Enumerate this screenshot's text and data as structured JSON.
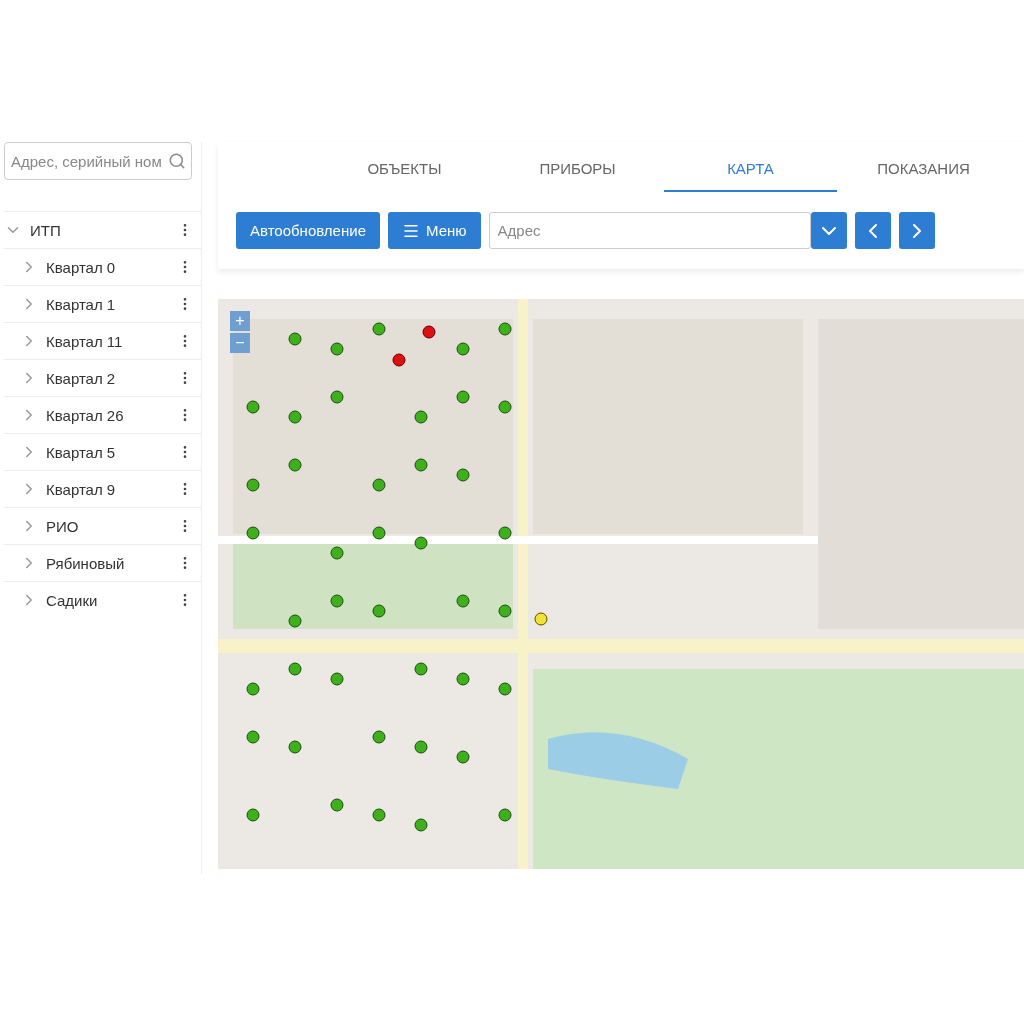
{
  "sidebar": {
    "search": {
      "placeholder": "Адрес, серийный ном"
    },
    "tree": [
      {
        "label": "ИТП",
        "expanded": true,
        "children": [
          {
            "label": "Квартал 0",
            "expanded": false
          },
          {
            "label": "Квартал 1",
            "expanded": false
          },
          {
            "label": "Квартал 11",
            "expanded": false
          },
          {
            "label": "Квартал 2",
            "expanded": false
          },
          {
            "label": "Квартал 26",
            "expanded": false
          },
          {
            "label": "Квартал 5",
            "expanded": false
          },
          {
            "label": "Квартал 9",
            "expanded": false
          },
          {
            "label": "РИО",
            "expanded": false
          },
          {
            "label": "Рябиновый",
            "expanded": false
          },
          {
            "label": "Садики",
            "expanded": false
          }
        ]
      }
    ]
  },
  "tabs": [
    {
      "label": "ОБЪЕКТЫ",
      "selected": false
    },
    {
      "label": "ПРИБОРЫ",
      "selected": false
    },
    {
      "label": "КАРТА",
      "selected": true
    },
    {
      "label": "ПОКАЗАНИЯ",
      "selected": false
    }
  ],
  "toolbar": {
    "auto_update": "Автообновление",
    "menu": "Меню",
    "address": {
      "placeholder": "Адрес"
    }
  },
  "map": {
    "zoom_in": "+",
    "zoom_out": "−"
  }
}
